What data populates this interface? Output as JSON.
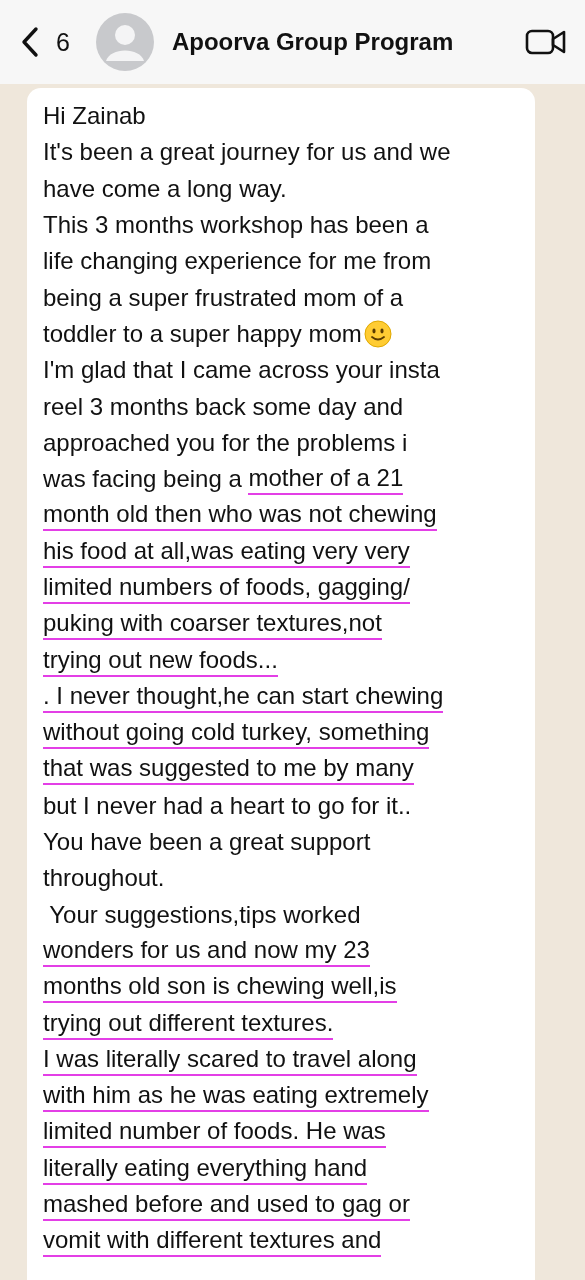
{
  "header": {
    "back_count": "6",
    "title": "Apoorva Group Program"
  },
  "message": {
    "lines": [
      {
        "text": "Hi Zainab",
        "underlined": false
      },
      {
        "text": "It's been a great journey for us and we",
        "underlined": false
      },
      {
        "text": "have come a long way.",
        "underlined": false
      },
      {
        "text": "This 3 months workshop has been a",
        "underlined": false
      },
      {
        "text": "life changing experience for me from",
        "underlined": false
      },
      {
        "text": "being a super frustrated mom of a",
        "underlined": false
      },
      {
        "text": "toddler to a super happy mom",
        "underlined": false,
        "kind": "smiley"
      },
      {
        "text": "I'm glad that I came across your insta",
        "underlined": false
      },
      {
        "text": "reel 3 months back some day and",
        "underlined": false
      },
      {
        "text": "approached you for the problems i",
        "underlined": false
      },
      {
        "lead": "was facing being a ",
        "text": "mother of a 21",
        "underlined": true
      },
      {
        "text": "month old then who was not chewing",
        "underlined": true
      },
      {
        "text": "his food at all,was eating very very",
        "underlined": true
      },
      {
        "text": "limited numbers of foods, gagging/",
        "underlined": true
      },
      {
        "text": "puking with coarser textures,not",
        "underlined": true
      },
      {
        "text": "trying out new foods...",
        "underlined": true
      },
      {
        "text": ". I never thought,he can start chewing",
        "underlined": true
      },
      {
        "text": "without going cold turkey, something",
        "underlined": true
      },
      {
        "text": "that was suggested to me by many",
        "underlined": true
      },
      {
        "text": "but I never had a heart to go for it..",
        "underlined": false
      },
      {
        "text": "You have been a great support",
        "underlined": false
      },
      {
        "text": "throughout.",
        "underlined": false
      },
      {
        "text": " Your suggestions,tips worked",
        "underlined": false
      },
      {
        "text": "wonders for us and now my 23",
        "underlined": true
      },
      {
        "text": "months old son is chewing well,is",
        "underlined": true
      },
      {
        "text": "trying out different textures.",
        "underlined": true
      },
      {
        "text": "I was literally scared to travel along",
        "underlined": true
      },
      {
        "text": "with him as he was eating extremely",
        "underlined": true
      },
      {
        "text": "limited number of foods. He was",
        "underlined": true
      },
      {
        "text": "literally eating everything hand",
        "underlined": true
      },
      {
        "text": "mashed before and used to gag or",
        "underlined": true
      },
      {
        "text": "vomit with different textures and",
        "underlined": true
      }
    ]
  }
}
